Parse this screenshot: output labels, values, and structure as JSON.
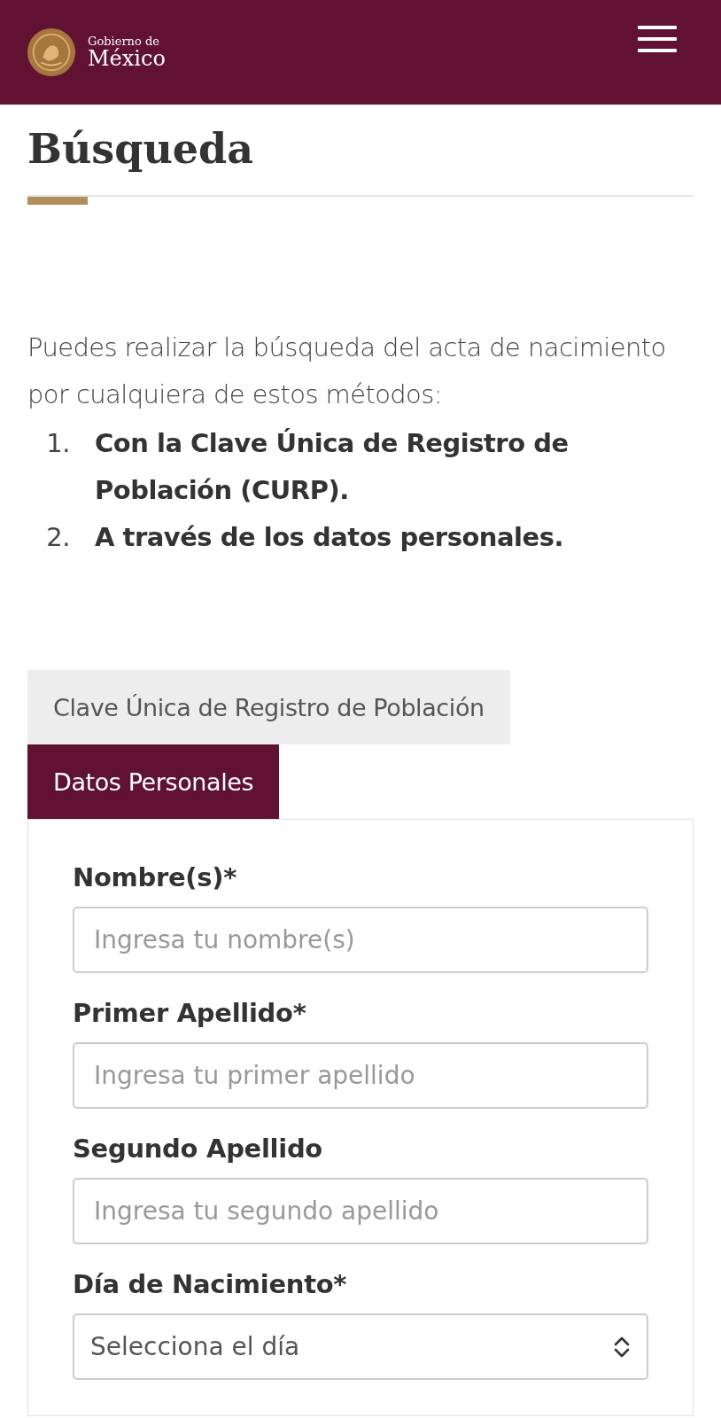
{
  "header": {
    "brand_small": "Gobierno de",
    "brand_large": "México"
  },
  "page": {
    "title": "Búsqueda",
    "intro": "Puedes realizar la búsqueda del acta de nacimiento por cualquiera de estos métodos:",
    "methods": [
      {
        "number": "1.",
        "text": "Con la Clave Única de Registro de Población (CURP)."
      },
      {
        "number": "2.",
        "text": "A través de los datos personales."
      }
    ]
  },
  "tabs": [
    {
      "label": "Clave Única de Registro de Población",
      "selected": false
    },
    {
      "label": "Datos Personales",
      "selected": true
    }
  ],
  "form": {
    "fields": [
      {
        "kind": "text",
        "label": "Nombre(s)*",
        "placeholder": "Ingresa tu nombre(s)"
      },
      {
        "kind": "text",
        "label": "Primer Apellido*",
        "placeholder": "Ingresa tu primer apellido"
      },
      {
        "kind": "text",
        "label": "Segundo Apellido",
        "placeholder": "Ingresa tu segundo apellido"
      },
      {
        "kind": "select",
        "label": "Día de Nacimiento*",
        "value": "Selecciona el día"
      }
    ]
  }
}
